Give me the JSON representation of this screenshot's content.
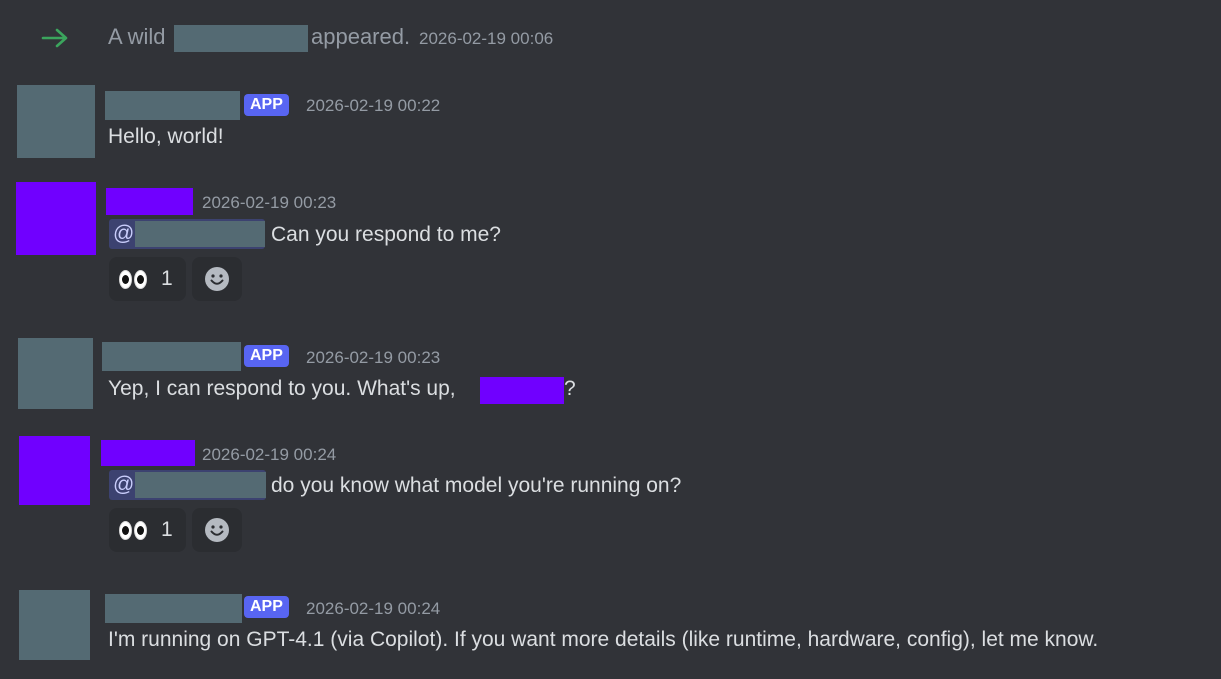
{
  "system": {
    "prefix": "A wild",
    "suffix": "appeared.",
    "timestamp": "2026-02-19 00:06",
    "arrow_icon": "arrow-right-icon",
    "arrow_color": "#3ba55d"
  },
  "badge_label": "APP",
  "messages": [
    {
      "timestamp": "2026-02-19 00:22",
      "text": "Hello, world!"
    },
    {
      "timestamp": "2026-02-19 00:23",
      "mention_at": "@",
      "text": "Can you respond to me?",
      "reaction_count": "1",
      "reaction_icon": "eyes-emoji-icon"
    },
    {
      "timestamp": "2026-02-19 00:23",
      "text_before": "Yep, I can respond to you. What's up,",
      "text_after": "?"
    },
    {
      "timestamp": "2026-02-19 00:24",
      "mention_at": "@",
      "text": "do you know what model you're running on?",
      "reaction_count": "1",
      "reaction_icon": "eyes-emoji-icon"
    },
    {
      "timestamp": "2026-02-19 00:24",
      "text": "I'm running on GPT-4.1 (via Copilot). If you want more details (like runtime, hardware, config), let me know."
    }
  ],
  "colors": {
    "background": "#313338",
    "redacted_gray": "#546a73",
    "redacted_purple": "#7000ff",
    "app_badge": "#5865f2",
    "mention_bg": "#3c4270"
  }
}
